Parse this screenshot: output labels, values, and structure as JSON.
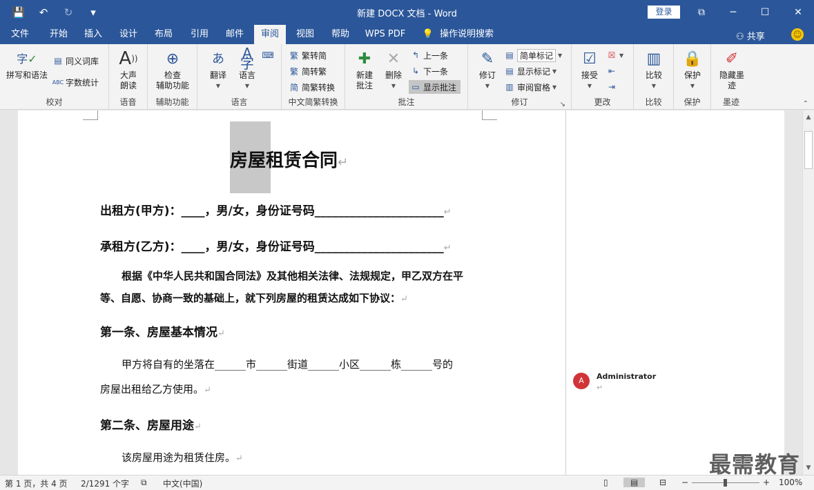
{
  "window": {
    "title": "新建 DOCX 文档  -  Word",
    "login_label": "登录",
    "qat": {
      "save": "💾",
      "undo": "↶",
      "redo": "↻",
      "customize": "▾"
    },
    "controls": {
      "ribbon_opts": "⧉",
      "minimize": "─",
      "maximize": "☐",
      "close": "✕"
    }
  },
  "tabs": [
    {
      "label": "文件"
    },
    {
      "label": "开始"
    },
    {
      "label": "插入"
    },
    {
      "label": "设计"
    },
    {
      "label": "布局"
    },
    {
      "label": "引用"
    },
    {
      "label": "邮件"
    },
    {
      "label": "审阅"
    },
    {
      "label": "视图"
    },
    {
      "label": "帮助"
    },
    {
      "label": "WPS PDF"
    },
    {
      "label": "操作说明搜索"
    }
  ],
  "active_tab": "审阅",
  "share_label": "共享",
  "ribbon": {
    "proofing": {
      "label": "校对",
      "spell": "拼写和语法",
      "thesaurus": "同义词库",
      "wordcount": "字数统计"
    },
    "speech": {
      "label": "语音",
      "read_aloud": "大声\n朗读"
    },
    "accessibility": {
      "label": "辅助功能",
      "check": "检查\n辅助功能"
    },
    "language": {
      "label": "语言",
      "translate": "翻译",
      "lang": "语言"
    },
    "chinese": {
      "label": "中文简繁转换",
      "to_simp": "繁转简",
      "to_trad": "简转繁",
      "convert": "简繁转换"
    },
    "comments": {
      "label": "批注",
      "new": "新建\n批注",
      "delete": "删除",
      "prev": "上一条",
      "next": "下一条",
      "show": "显示批注"
    },
    "tracking": {
      "label": "修订",
      "track": "修订",
      "markup": "简单标记",
      "show_markup": "显示标记",
      "pane": "审阅窗格"
    },
    "changes": {
      "label": "更改",
      "accept": "接受"
    },
    "compare": {
      "label": "比较",
      "compare": "比较"
    },
    "protect": {
      "label": "保护",
      "protect": "保护"
    },
    "ink": {
      "label": "墨迹",
      "hide": "隐藏墨\n迹"
    }
  },
  "document": {
    "title": "房屋租赁合同",
    "lessor": "出租方(甲方)：____，男/女，身份证号码______________________",
    "lessee": "承租方(乙方)：____，男/女，身份证号码______________________",
    "preamble_1": "根据《中华人民共和国合同法》及其他相关法律、法规规定，甲乙双方在平",
    "preamble_2": "等、自愿、协商一致的基础上，就下列房屋的租赁达成如下协议：",
    "art1_heading": "第一条、房屋基本情况",
    "art1_line1": "甲方将自有的坐落在______市______街道______小区______栋______号的",
    "art1_line2": "房屋出租给乙方使用。",
    "art2_heading": "第二条、房屋用途",
    "art2_line1": "该房屋用途为租赁住房。",
    "para_mark": "↵"
  },
  "comment": {
    "initial": "A",
    "author": "Administrator",
    "body": "↵"
  },
  "status": {
    "page": "第 1 页，共 4 页",
    "words": "2/1291 个字",
    "lang": "中文(中国)",
    "zoom": "100%",
    "zoom_minus": "−",
    "zoom_plus": "+"
  },
  "watermark": "最需教育"
}
